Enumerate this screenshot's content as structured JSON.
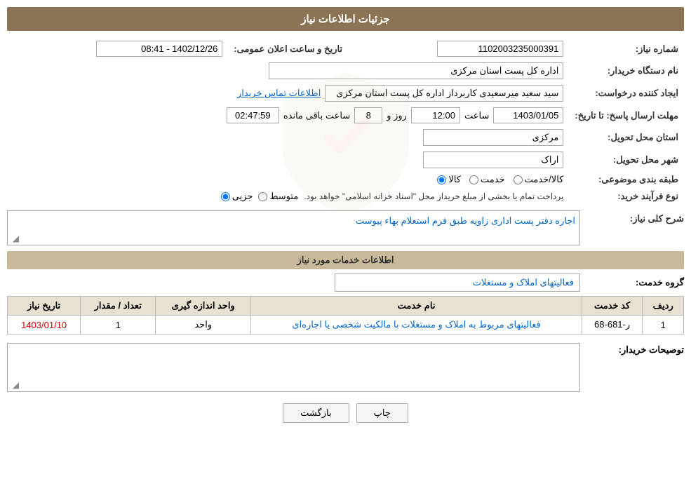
{
  "page": {
    "main_title": "جزئیات اطلاعات نیاز",
    "section_services": "اطلاعات خدمات مورد نیاز"
  },
  "header": {
    "need_number_label": "شماره نیاز:",
    "need_number_value": "1102003235000391",
    "announcement_date_label": "تاریخ و ساعت اعلان عمومی:",
    "announcement_date_value": "1402/12/26 - 08:41",
    "buyer_org_label": "نام دستگاه خریدار:",
    "buyer_org_value": "اداره کل پست استان مرکزی",
    "creator_label": "ایجاد کننده درخواست:",
    "creator_value": "سید سعید میرسعیدی کاربرداز اداره کل پست استان مرکزی",
    "contact_link": "اطلاعات تماس خریدار",
    "response_deadline_label": "مهلت ارسال پاسخ: تا تاریخ:",
    "response_date_value": "1403/01/05",
    "response_time_label": "ساعت",
    "response_time_value": "12:00",
    "response_days_label": "روز و",
    "response_days_value": "8",
    "remaining_label": "ساعت باقی مانده",
    "remaining_value": "02:47:59",
    "province_label": "استان محل تحویل:",
    "province_value": "مرکزی",
    "city_label": "شهر محل تحویل:",
    "city_value": "اراک",
    "category_label": "طبقه بندی موضوعی:",
    "category_kala": "کالا",
    "category_khadamat": "خدمت",
    "category_kala_khadamat": "کالا/خدمت",
    "process_label": "نوع فرآیند خرید:",
    "process_jazzi": "جزیی",
    "process_motevaset": "متوسط",
    "process_note": "پرداخت تمام یا بخشی از مبلغ خریداز محل \"اسناد خزانه اسلامی\" خواهد بود.",
    "sharh_label": "شرح کلی نیاز:",
    "sharh_value": "اجاره دفتر پست اداری زاویه طبق فرم استعلام بهاء پیوست",
    "group_service_label": "گروه خدمت:",
    "group_service_value": "فعالیتهای  املاک  و مستغلات"
  },
  "services_table": {
    "col_row": "ردیف",
    "col_code": "کد خدمت",
    "col_name": "نام خدمت",
    "col_unit": "واحد اندازه گیری",
    "col_quantity": "تعداد / مقدار",
    "col_date": "تاریخ نیاز",
    "rows": [
      {
        "row": "1",
        "code": "ر-681-68",
        "name": "فعالیتهای مربوط به املاک و مستغلات با مالکیت شخصی یا اجاره‌ای",
        "unit": "واحد",
        "quantity": "1",
        "date": "1403/01/10"
      }
    ]
  },
  "buyer_description_label": "توصیحات خریدار:",
  "buttons": {
    "print": "چاپ",
    "back": "بازگشت"
  }
}
